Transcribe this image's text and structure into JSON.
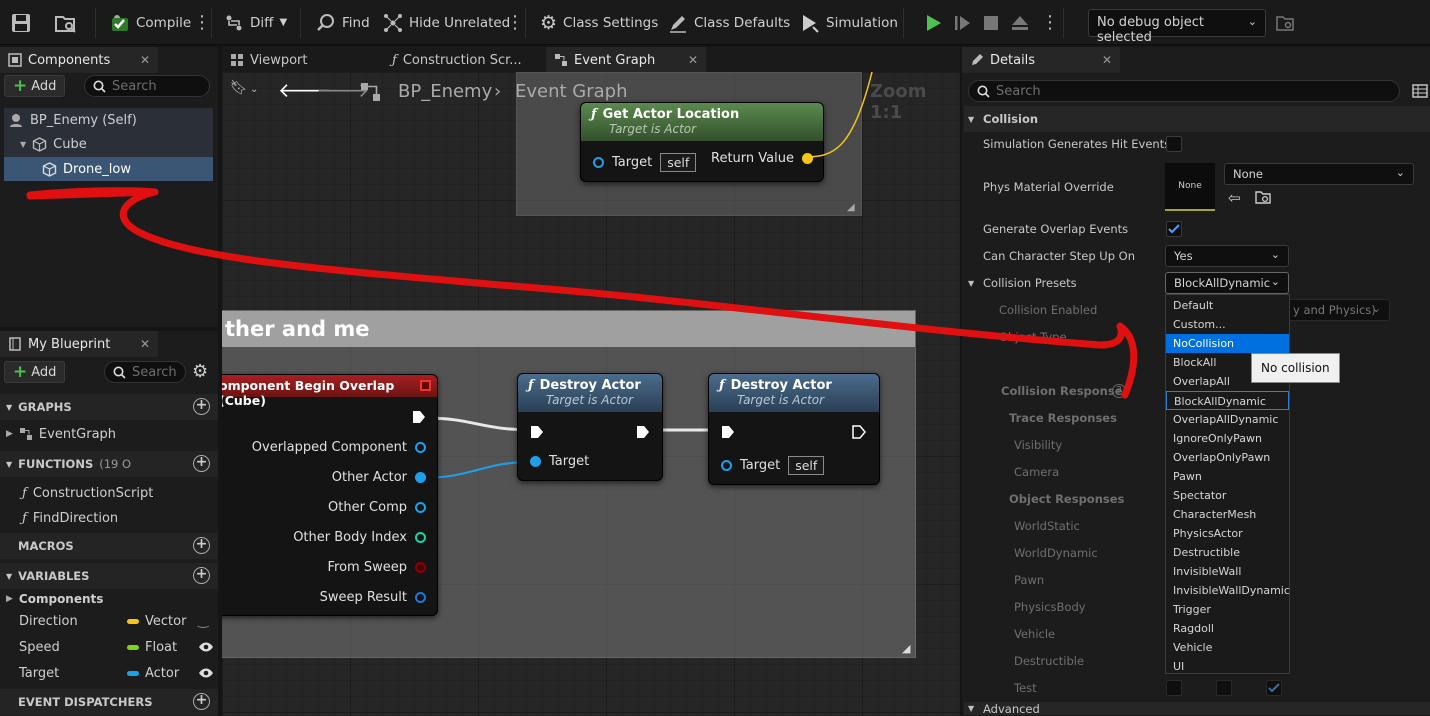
{
  "toolbar": {
    "compile": "Compile",
    "diff": "Diff",
    "find": "Find",
    "hide_unrelated": "Hide Unrelated",
    "class_settings": "Class Settings",
    "class_defaults": "Class Defaults",
    "simulation": "Simulation",
    "debug_object": "No debug object selected"
  },
  "components": {
    "tab": "Components",
    "add": "Add",
    "search_placeholder": "Search",
    "items": [
      "BP_Enemy (Self)",
      "Cube",
      "Drone_low"
    ]
  },
  "my_blueprint": {
    "tab": "My Blueprint",
    "add": "Add",
    "search_placeholder": "Search",
    "graphs_header": "GRAPHS",
    "graphs": [
      "EventGraph"
    ],
    "functions_header": "FUNCTIONS",
    "functions_count": "(19 O",
    "functions": [
      "ConstructionScript",
      "FindDirection"
    ],
    "macros_header": "MACROS",
    "variables_header": "VARIABLES",
    "variables_group": "Components",
    "variables": [
      {
        "name": "Direction",
        "type": "Vector",
        "color": "#f5c518"
      },
      {
        "name": "Speed",
        "type": "Float",
        "color": "#7ed321"
      },
      {
        "name": "Target",
        "type": "Actor",
        "color": "#1ea0e8"
      }
    ],
    "dispatchers_header": "EVENT DISPATCHERS"
  },
  "editor_tabs": [
    "Viewport",
    "Construction Scr...",
    "Event Graph"
  ],
  "graph": {
    "blueprint_name": "BP_Enemy",
    "graph_name": "Event Graph",
    "zoom": "Zoom 1:1",
    "comment_title": "ther and me",
    "get_actor_location": {
      "title": "Get Actor Location",
      "subtitle": "Target is Actor",
      "target": "Target",
      "self": "self",
      "return": "Return Value"
    },
    "overlap_event": {
      "title": "omponent Begin Overlap (Cube)",
      "pins": [
        "Overlapped Component",
        "Other Actor",
        "Other Comp",
        "Other Body Index",
        "From Sweep",
        "Sweep Result"
      ]
    },
    "destroy1": {
      "title": "Destroy Actor",
      "subtitle": "Target is Actor",
      "target": "Target"
    },
    "destroy2": {
      "title": "Destroy Actor",
      "subtitle": "Target is Actor",
      "target": "Target",
      "self": "self"
    }
  },
  "details": {
    "tab": "Details",
    "search_placeholder": "Search",
    "collision_header": "Collision",
    "rows": {
      "sim_hit": "Simulation Generates Hit Events",
      "phys_mat": "Phys Material Override",
      "phys_mat_thumb": "None",
      "phys_mat_value": "None",
      "overlap": "Generate Overlap Events",
      "step_up": "Can Character Step Up On",
      "step_up_value": "Yes",
      "presets": "Collision Presets",
      "presets_value": "BlockAllDynamic",
      "enabled": "Collision Enabled",
      "enabled_value": "y and Physics)",
      "object_type": "Object Type",
      "responses": "Collision Responses",
      "trace": "Trace Responses",
      "visibility": "Visibility",
      "camera": "Camera",
      "object_responses": "Object Responses",
      "world_static": "WorldStatic",
      "world_dynamic": "WorldDynamic",
      "pawn": "Pawn",
      "physics_body": "PhysicsBody",
      "vehicle": "Vehicle",
      "destructible": "Destructible",
      "test": "Test",
      "advanced": "Advanced"
    }
  },
  "dropdown": {
    "options": [
      "Default",
      "Custom...",
      "NoCollision",
      "BlockAll",
      "OverlapAll",
      "BlockAllDynamic",
      "OverlapAllDynamic",
      "IgnoreOnlyPawn",
      "OverlapOnlyPawn",
      "Pawn",
      "Spectator",
      "CharacterMesh",
      "PhysicsActor",
      "Destructible",
      "InvisibleWall",
      "InvisibleWallDynamic",
      "Trigger",
      "Ragdoll",
      "Vehicle",
      "UI"
    ],
    "highlighted": "NoCollision",
    "selected": "BlockAllDynamic",
    "tooltip": "No collision"
  }
}
